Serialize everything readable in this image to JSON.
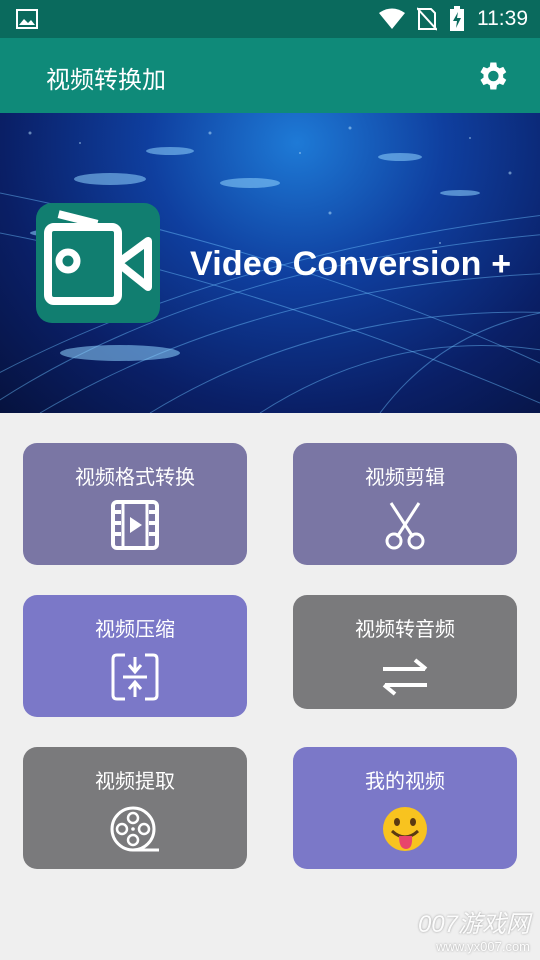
{
  "status_bar": {
    "time": "11:39"
  },
  "app_bar": {
    "title": "视频转换加"
  },
  "banner": {
    "tagline": "Video Conversion +"
  },
  "cards": [
    {
      "label": "视频格式转换",
      "icon": "film-play-icon"
    },
    {
      "label": "视频剪辑",
      "icon": "scissors-icon"
    },
    {
      "label": "视频压缩",
      "icon": "compress-icon"
    },
    {
      "label": "视频转音频",
      "icon": "swap-arrows-icon"
    },
    {
      "label": "视频提取",
      "icon": "film-reel-icon"
    },
    {
      "label": "我的视频",
      "icon": "tongue-emoji-icon"
    }
  ],
  "colors": {
    "status_bar": "#0a6a5d",
    "app_bar": "#0f8a79",
    "card_purple_gray": "#7a76a4",
    "card_violet": "#7b78c8",
    "card_gray": "#7a7a7c"
  },
  "watermark": {
    "line1": "007游戏网",
    "line2": "www.yx007.com"
  }
}
